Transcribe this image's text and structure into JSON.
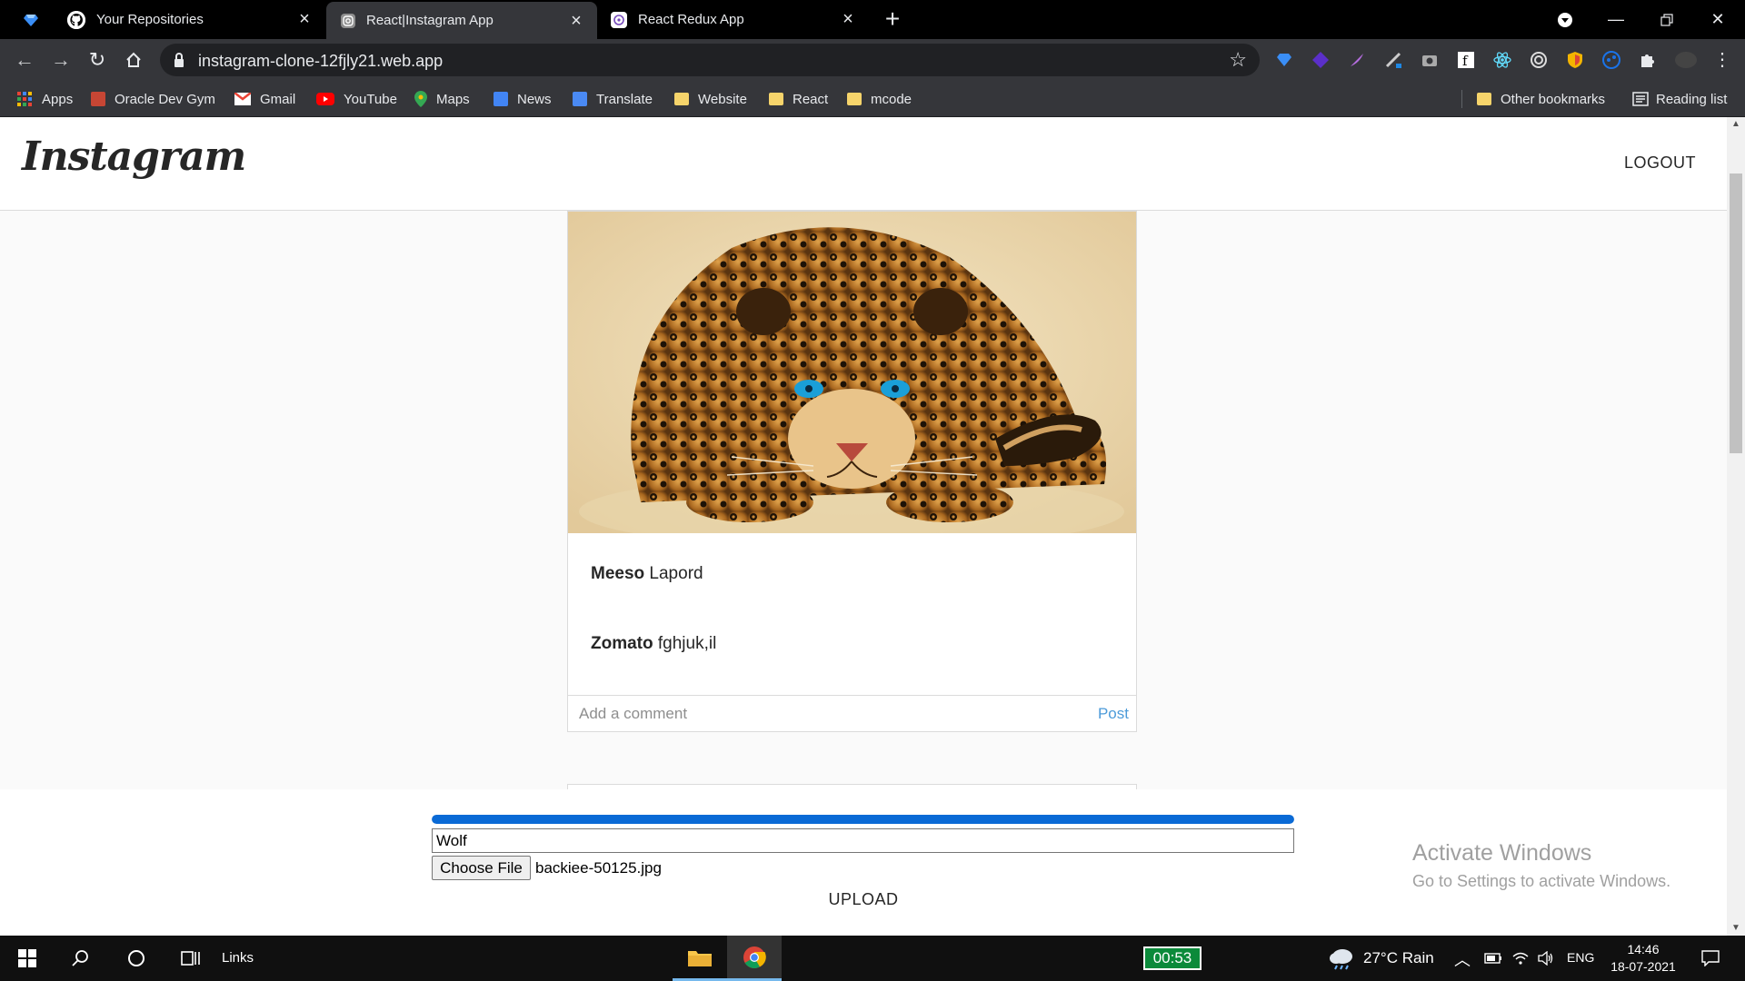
{
  "browser": {
    "tabs": [
      {
        "title": "Your Repositories",
        "active": false
      },
      {
        "title": "React|Instagram App",
        "active": true
      },
      {
        "title": "React Redux App",
        "active": false
      }
    ],
    "url": "instagram-clone-12fjly21.web.app",
    "bookmarks": [
      {
        "label": "Apps"
      },
      {
        "label": "Oracle Dev Gym"
      },
      {
        "label": "Gmail"
      },
      {
        "label": "YouTube"
      },
      {
        "label": "Maps"
      },
      {
        "label": "News"
      },
      {
        "label": "Translate"
      },
      {
        "label": "Website"
      },
      {
        "label": "React"
      },
      {
        "label": "mcode"
      }
    ],
    "other_bookmarks": "Other bookmarks",
    "reading_list": "Reading list"
  },
  "app": {
    "logo": "Instagram",
    "logout_label": "LOGOUT"
  },
  "post": {
    "image_subject": "leopard",
    "captions": [
      {
        "username": "Meeso",
        "text": "Lapord"
      },
      {
        "username": "Zomato",
        "text": "fghjuk,il"
      }
    ],
    "comment_placeholder": "Add a comment",
    "post_label": "Post"
  },
  "upload": {
    "progress_percent": 100,
    "caption_value": "Wolf",
    "choose_file_label": "Choose File",
    "file_name": "backiee-50125.jpg",
    "upload_label": "UPLOAD"
  },
  "watermark": {
    "title": "Activate Windows",
    "subtitle": "Go to Settings to activate Windows."
  },
  "taskbar": {
    "links_label": "Links",
    "timer": "00:53",
    "weather": "27°C  Rain",
    "language": "ENG",
    "time": "14:46",
    "date": "18-07-2021"
  },
  "colors": {
    "progress": "#0a6ad6",
    "post_button": "#4c9bd9"
  }
}
